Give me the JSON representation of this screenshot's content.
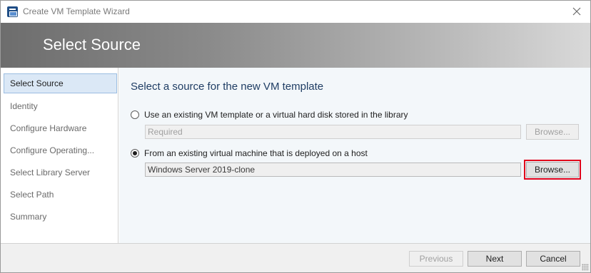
{
  "window": {
    "title": "Create VM Template Wizard"
  },
  "banner": {
    "title": "Select Source"
  },
  "nav": {
    "items": [
      {
        "label": "Select Source",
        "active": true
      },
      {
        "label": "Identity"
      },
      {
        "label": "Configure Hardware"
      },
      {
        "label": "Configure Operating..."
      },
      {
        "label": "Select Library Server"
      },
      {
        "label": "Select Path"
      },
      {
        "label": "Summary"
      }
    ]
  },
  "main": {
    "heading": "Select a source for the new VM template",
    "option_library": {
      "label": "Use an existing VM template or a virtual hard disk stored in the library",
      "checked": false,
      "field_placeholder": "Required",
      "browse_label": "Browse..."
    },
    "option_host": {
      "label": "From an existing virtual machine that is deployed on a host",
      "checked": true,
      "field_value": "Windows Server 2019-clone",
      "browse_label": "Browse..."
    }
  },
  "footer": {
    "previous_label": "Previous",
    "next_label": "Next",
    "cancel_label": "Cancel"
  },
  "colors": {
    "accent": "#1f3d64",
    "selected_nav": "#dbe8f6",
    "highlight_border": "#e0001b"
  }
}
